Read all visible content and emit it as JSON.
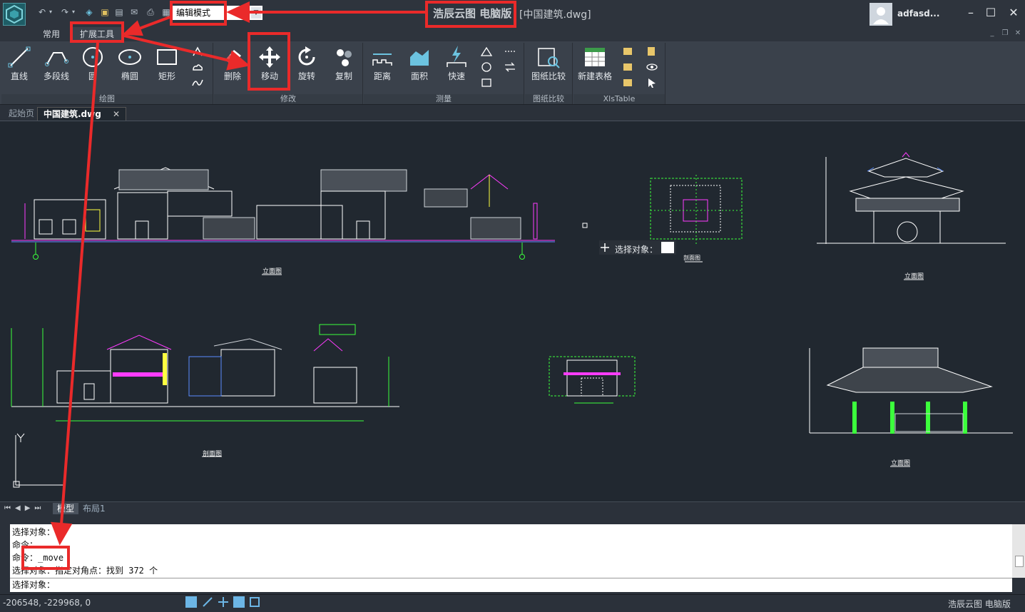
{
  "titlebar": {
    "mode_value": "编辑模式",
    "app_name": "浩辰云图 电脑版",
    "doc_title": "[中国建筑.dwg]",
    "username": "adfasd..."
  },
  "ribbon_tabs": [
    "常用",
    "扩展工具"
  ],
  "ribbon": {
    "draw_group": "绘图",
    "draw_buttons": [
      "直线",
      "多段线",
      "圆",
      "椭圆",
      "矩形"
    ],
    "modify_group": "修改",
    "modify_buttons": [
      "删除",
      "移动",
      "旋转",
      "复制"
    ],
    "measure_group": "测量",
    "measure_buttons": [
      "距离",
      "面积",
      "快速"
    ],
    "compare_group": "图纸比较",
    "compare_button": "图纸比较",
    "xls_group": "XlsTable",
    "xls_button": "新建表格"
  },
  "doc_tabs": [
    "起始页",
    "中国建筑.dwg"
  ],
  "canvas": {
    "prompt_label": "选择对象：",
    "drawing_labels": [
      "立面图",
      "剖面图",
      "立面图",
      "立面图",
      "剖面图"
    ]
  },
  "layout_tabs": [
    "模型",
    "布局1"
  ],
  "command_lines": [
    "选择对象：",
    "命令：",
    "命令：_move",
    "选择对象：指定对角点：找到 372 个",
    "选择对象："
  ],
  "status": {
    "coords": "-206548, -229968, 0",
    "brand": "浩辰云图 电脑版"
  },
  "colors": {
    "accent_red": "#ea2a2a",
    "canvas_bg": "#212830",
    "ribbon_bg": "#3a414b"
  }
}
